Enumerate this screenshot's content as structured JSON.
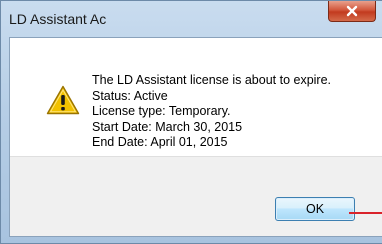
{
  "window": {
    "title": "LD Assistant Ac"
  },
  "icons": {
    "close": "close-icon",
    "warning": "warning-icon"
  },
  "message": {
    "line1": "The LD Assistant license is about to expire.",
    "line2": "Status: Active",
    "line3": "License type: Temporary.",
    "line4": "Start Date: March 30, 2015",
    "line5": "End Date: April 01, 2015"
  },
  "buttons": {
    "ok_label": "OK"
  },
  "colors": {
    "warning_fill": "#f2c200",
    "close_button": "#c9452a",
    "arrow": "#d9232b"
  }
}
